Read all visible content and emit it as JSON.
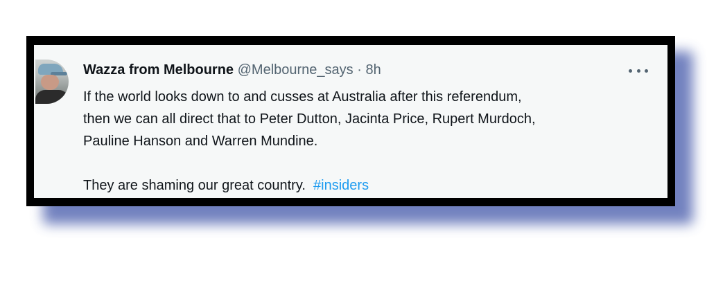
{
  "tweet": {
    "author_name": "Wazza from Melbourne",
    "handle": "@Melbourne_says",
    "separator": "·",
    "time": "8h",
    "more_icon": "more-horizontal-icon",
    "avatar_icon": "user-avatar",
    "text_line_1": "If the world looks down to and cusses at Australia after this referendum,",
    "text_line_2": "then we can all direct that to Peter Dutton, Jacinta Price, Rupert Murdoch,",
    "text_line_3": "Pauline Hanson and Warren Mundine.",
    "text_line_4": "They are shaming our great country.",
    "hashtag": "#insiders"
  },
  "colors": {
    "frame": "#000000",
    "shadow": "#5a6cb4",
    "card_background": "#f6f8f8",
    "text_primary": "#0f1419",
    "text_secondary": "#536471",
    "link": "#1d9bf0"
  }
}
